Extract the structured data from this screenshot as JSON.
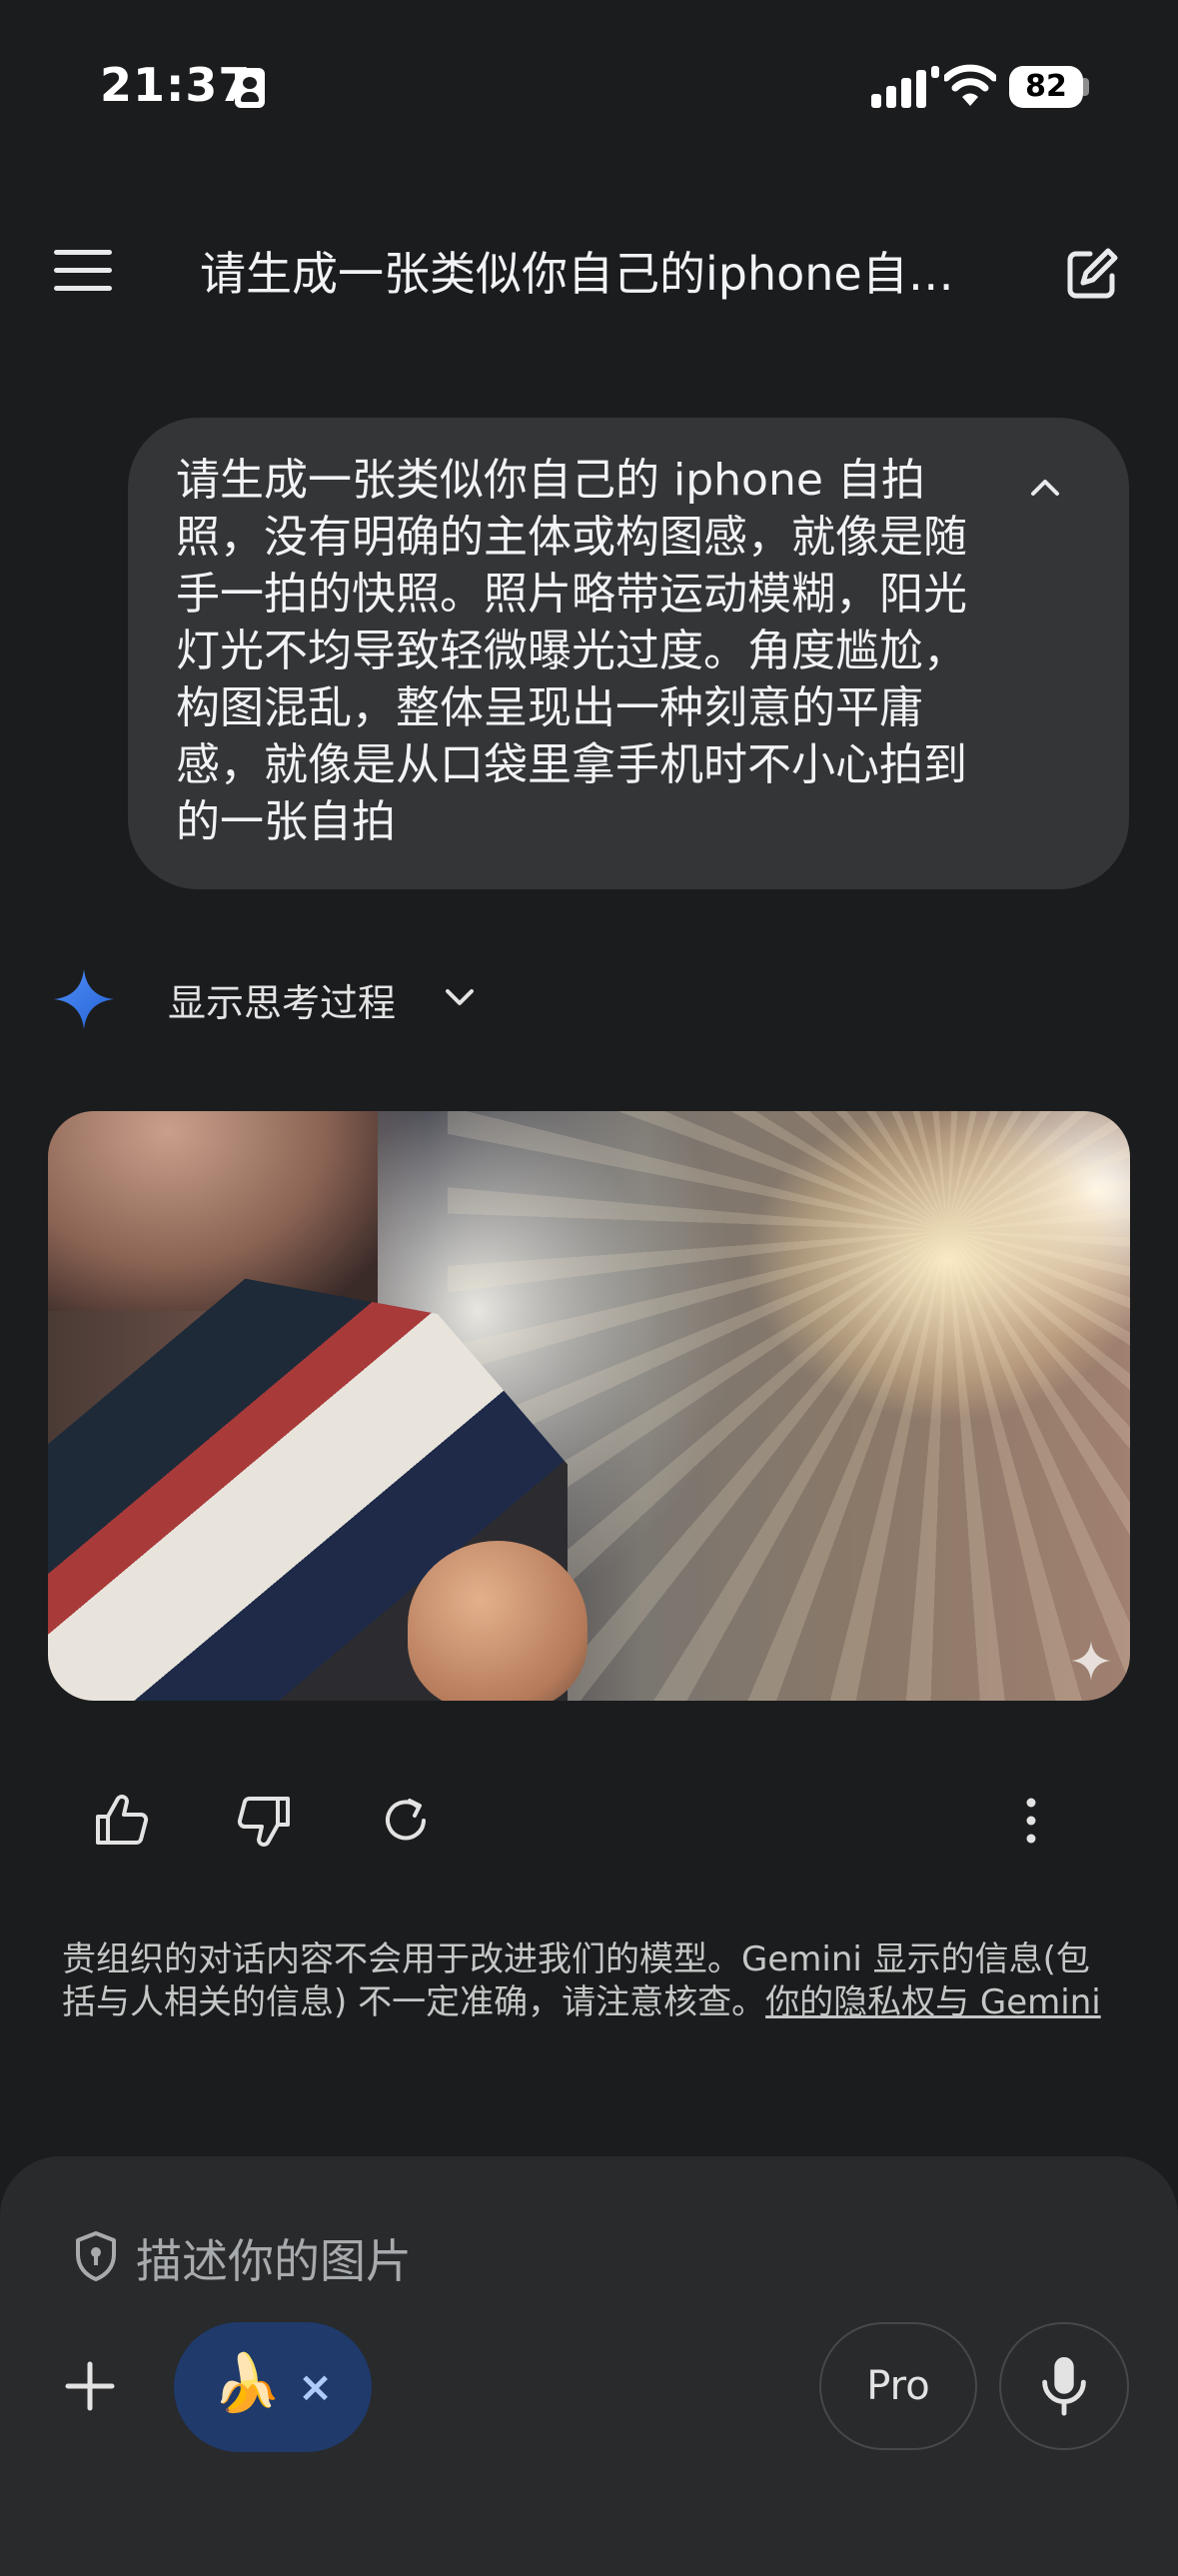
{
  "status_bar": {
    "time": "21:37",
    "battery": "82"
  },
  "header": {
    "title": "请生成一张类似你自己的iphone自…"
  },
  "user_message": {
    "text": "请生成一张类似你自己的 iphone 自拍照，没有明确的主体或构图感，就像是随手一拍的快照。照片略带运动模糊，阳光灯光不均导致轻微曝光过度。角度尴尬，构图混乱，整体呈现出一种刻意的平庸感，就像是从口袋里拿手机时不小心拍到的一张自拍"
  },
  "response": {
    "show_thinking_label": "显示思考过程"
  },
  "disclaimer": {
    "text": "贵组织的对话内容不会用于改进我们的模型。Gemini 显示的信息(包括与人相关的信息) 不一定准确，请注意核查。",
    "link": "你的隐私权与 Gemini"
  },
  "composer": {
    "placeholder": "描述你的图片",
    "chip_emoji": "🍌",
    "chip_close": "×",
    "pro_label": "Pro"
  }
}
